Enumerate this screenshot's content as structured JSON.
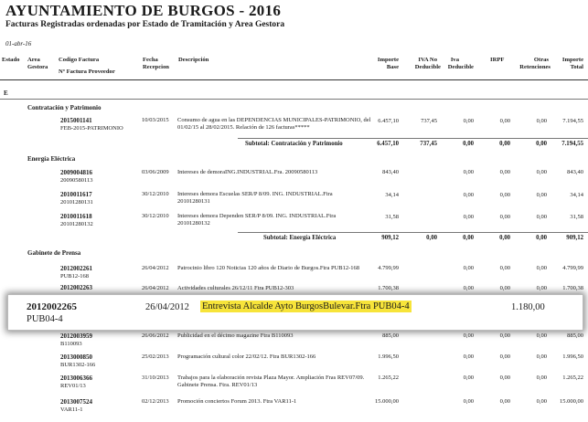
{
  "report": {
    "title": "AYUNTAMIENTO DE BURGOS - 2016",
    "subtitle": "Facturas Registradas ordenadas  por Estado de Tramitación y Area Gestora",
    "date": "01-abr-16"
  },
  "columns": {
    "estado": "Estado",
    "area": "Area",
    "gestora": "Gestora",
    "codigo": "Codigo Factura",
    "nfactura": "Nº Factura Proveedor",
    "fecha": "Fecha",
    "recepcion": "Recepcion",
    "descripcion": "Descripción",
    "importe1": "Importe",
    "importe2": "Base",
    "iva1": "IVA No",
    "iva2": "Deducible",
    "iva3": "Iva",
    "iva4": "Deducible",
    "irpf": "IRPF",
    "otras1": "Otras",
    "otras2": "Retenciones",
    "total1": "Importe",
    "total2": "Total"
  },
  "estado_letter": "E",
  "groups": [
    {
      "name": "Contratación y Patrimonio",
      "rows": [
        {
          "code": "2015001141",
          "ref": "FEB-2015-PATRIMONIO",
          "date": "10/03/2015",
          "desc": "Consumo de agua en las DEPENDENCIAS MUNICIPALES-PATRIMONIO, del 01/02/15 al 28/02/2015. Relación de 126 facturas*****",
          "base": "6.457,10",
          "ivand": "737,45",
          "iva": "0,00",
          "irpf": "0,00",
          "otras": "0,00",
          "total": "7.194,55"
        }
      ],
      "subtotal": {
        "label": "Subtotal:  Contratación y Patrimonio",
        "base": "6.457,10",
        "ivand": "737,45",
        "iva": "0,00",
        "irpf": "0,00",
        "otras": "0,00",
        "total": "7.194,55"
      }
    },
    {
      "name": "Energía Eléctrica",
      "rows": [
        {
          "code": "2009004816",
          "ref": "20090580113",
          "date": "03/06/2009",
          "desc": "Intereses de demoraING.INDUSTRIAL.Fra. 20090580113",
          "base": "843,40",
          "ivand": "",
          "iva": "0,00",
          "irpf": "0,00",
          "otras": "0,00",
          "total": "843,40"
        },
        {
          "code": "2010011617",
          "ref": "20101280131",
          "date": "30/12/2010",
          "desc": "Intereses demora Escuelas SER/P 8/09. ING. INDUSTRIAL.Ftra 20101280131",
          "base": "34,14",
          "ivand": "",
          "iva": "0,00",
          "irpf": "0,00",
          "otras": "0,00",
          "total": "34,14"
        },
        {
          "code": "2010011618",
          "ref": "20101280132",
          "date": "30/12/2010",
          "desc": "Intereses demora Dependen SER/P 8/09. ING. INDUSTRIAL.Ftra 20101280132",
          "base": "31,58",
          "ivand": "",
          "iva": "0,00",
          "irpf": "0,00",
          "otras": "0,00",
          "total": "31,58"
        }
      ],
      "subtotal": {
        "label": "Subtotal:  Energía Eléctrica",
        "base": "909,12",
        "ivand": "0,00",
        "iva": "0,00",
        "irpf": "0,00",
        "otras": "0,00",
        "total": "909,12"
      }
    },
    {
      "name": "Gabinete de Prensa",
      "rows": [
        {
          "code": "2012002261",
          "ref": "PUB12-168",
          "date": "26/04/2012",
          "desc": "Patrocinio libro 120 Noticias 120 años de Diario de Burgos.Ftra PUB12-168",
          "base": "4.799,99",
          "ivand": "",
          "iva": "0,00",
          "irpf": "0,00",
          "otras": "0,00",
          "total": "4.799,99"
        },
        {
          "code": "2012002263",
          "ref": "",
          "date": "26/04/2012",
          "desc": "Actividades culturales 26/12/11 Ftra PUB12-303",
          "base": "1.700,38",
          "ivand": "",
          "iva": "0,00",
          "irpf": "0,00",
          "otras": "0,00",
          "total": "1.700,38"
        },
        {
          "code": "2012003959",
          "ref": "B110093",
          "date": "26/06/2012",
          "desc": "Publicidad en el décimo magazine Ftra B110093",
          "base": "885,00",
          "ivand": "",
          "iva": "0,00",
          "irpf": "0,00",
          "otras": "0,00",
          "total": "885,00"
        },
        {
          "code": "2013000850",
          "ref": "BUR1302-166",
          "date": "25/02/2013",
          "desc": "Programación cultural color 22/02/12. Ftra BUR1302-166",
          "base": "1.996,50",
          "ivand": "",
          "iva": "0,00",
          "irpf": "0,00",
          "otras": "0,00",
          "total": "1.996,50"
        },
        {
          "code": "2013006366",
          "ref": "REV01/13",
          "date": "31/10/2013",
          "desc": "Trabajos para la elaboración revista Plaza Mayor. Ampliación Fras REV07/09. Gabinete Prensa. Ftra. REV01/13",
          "base": "1.265,22",
          "ivand": "",
          "iva": "0,00",
          "irpf": "0,00",
          "otras": "0,00",
          "total": "1.265,22"
        },
        {
          "code": "2013007524",
          "ref": "VAR11-1",
          "date": "02/12/2013",
          "desc": "Promoción conciertos Forum 2013. Ftra VAR11-1",
          "base": "15.000,00",
          "ivand": "",
          "iva": "0,00",
          "irpf": "0,00",
          "otras": "0,00",
          "total": "15.000,00"
        }
      ]
    }
  ],
  "highlight": {
    "code": "2012002265",
    "ref": "PUB04-4",
    "date": "26/04/2012",
    "desc": "Entrevista Alcalde Ayto BurgosBulevar.Ftra PUB04-4",
    "amount": "1.180,00",
    "mark_color": "#f7e43a"
  }
}
